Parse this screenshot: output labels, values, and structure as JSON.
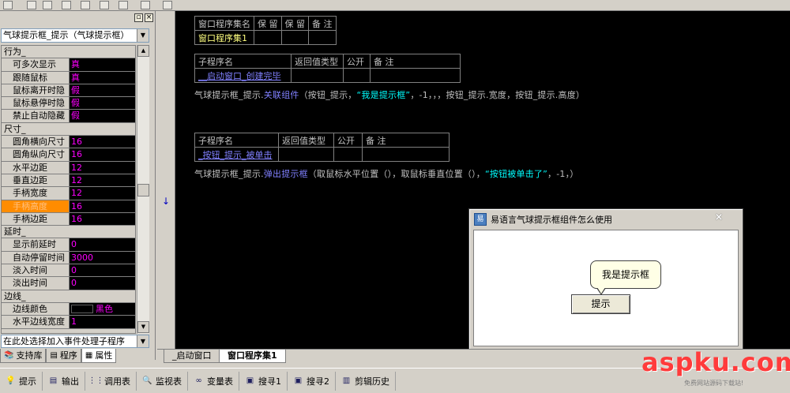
{
  "prop_panel": {
    "object_selector": "气球提示框_提示（气球提示框）",
    "categories": [
      {
        "label": "行为_",
        "props": [
          {
            "name": "可多次显示",
            "value": "真"
          },
          {
            "name": "跟随鼠标",
            "value": "真"
          },
          {
            "name": "鼠标离开时隐",
            "value": "假"
          },
          {
            "name": "鼠标悬停时隐",
            "value": "假"
          },
          {
            "name": "禁止自动隐藏",
            "value": "假"
          }
        ]
      },
      {
        "label": "尺寸_",
        "props": [
          {
            "name": "圆角横向尺寸",
            "value": "16"
          },
          {
            "name": "圆角纵向尺寸",
            "value": "16"
          },
          {
            "name": "水平边距",
            "value": "12"
          },
          {
            "name": "垂直边距",
            "value": "12"
          },
          {
            "name": "手柄宽度",
            "value": "12"
          },
          {
            "name": "手柄高度",
            "value": "16",
            "selected": true
          },
          {
            "name": "手柄边距",
            "value": "16"
          }
        ]
      },
      {
        "label": "延时_",
        "props": [
          {
            "name": "显示前延时",
            "value": "0"
          },
          {
            "name": "自动停留时间",
            "value": "3000"
          },
          {
            "name": "淡入时间",
            "value": "0"
          },
          {
            "name": "淡出时间",
            "value": "0"
          }
        ]
      },
      {
        "label": "边线_",
        "props": [
          {
            "name": "边线颜色",
            "value": "黑色",
            "swatch": "#000000"
          },
          {
            "name": "水平边线宽度",
            "value": "1"
          }
        ]
      }
    ],
    "event_selector": "在此处选择加入事件处理子程序",
    "tabs": [
      {
        "label": "支持库",
        "icon": "library-icon"
      },
      {
        "label": "程序",
        "icon": "program-icon"
      },
      {
        "label": "属性",
        "icon": "property-icon",
        "active": true
      }
    ]
  },
  "editor": {
    "assembly_table": {
      "headers": [
        "窗口程序集名",
        "保 留",
        "保 留",
        "备 注"
      ],
      "name": "窗口程序集1"
    },
    "sub1": {
      "headers": [
        "子程序名",
        "返回值类型",
        "公开",
        "备 注"
      ],
      "name": "__启动窗口_创建完毕",
      "code_prefix": "气球提示框_提示.",
      "code_fn": "关联组件",
      "code_args1": "（按钮_提示，",
      "code_str": "“我是提示框”",
      "code_args2": "，-1，，，按钮_提示.宽度，按钮_提示.高度）"
    },
    "sub2": {
      "headers": [
        "子程序名",
        "返回值类型",
        "公开",
        "备 注"
      ],
      "name": "_按钮_提示_被单击",
      "code_prefix": "气球提示框_提示.",
      "code_fn": "弹出提示框",
      "code_args1": "（取鼠标水平位置（），取鼠标垂直位置（），",
      "code_str": "“按钮被单击了”",
      "code_args2": "，-1，）"
    },
    "tabs": [
      "_启动窗口",
      "窗口程序集1"
    ]
  },
  "popup": {
    "title": "易语言气球提示框组件怎么使用",
    "app_icon_glyph": "易",
    "close_glyph": "×",
    "balloon_text": "我是提示框",
    "button_label": "提示"
  },
  "bottom_bar": {
    "buttons": [
      {
        "label": "提示",
        "icon": "bulb-icon",
        "glyph": "💡"
      },
      {
        "label": "输出",
        "icon": "output-icon",
        "glyph": "▤"
      },
      {
        "label": "调用表",
        "icon": "call-table-icon",
        "glyph": "⋮⋮"
      },
      {
        "label": "监视表",
        "icon": "watch-icon",
        "glyph": "🔍"
      },
      {
        "label": "变量表",
        "icon": "variable-icon",
        "glyph": "∞"
      },
      {
        "label": "搜寻1",
        "icon": "search1-icon",
        "glyph": "▣"
      },
      {
        "label": "搜寻2",
        "icon": "search2-icon",
        "glyph": "▣"
      },
      {
        "label": "剪辑历史",
        "icon": "clip-history-icon",
        "glyph": "▥"
      }
    ]
  },
  "watermark": {
    "brand": "aspku.com",
    "subtitle": "免费网站源码下载站!"
  },
  "colors": {
    "editor_bg": "#000000",
    "keyword_blue": "#8080ff",
    "string_cyan": "#00ffff",
    "value_magenta": "#ff00ff",
    "selected_orange": "#ff8c00",
    "assembly_yellow": "#ffff80"
  }
}
